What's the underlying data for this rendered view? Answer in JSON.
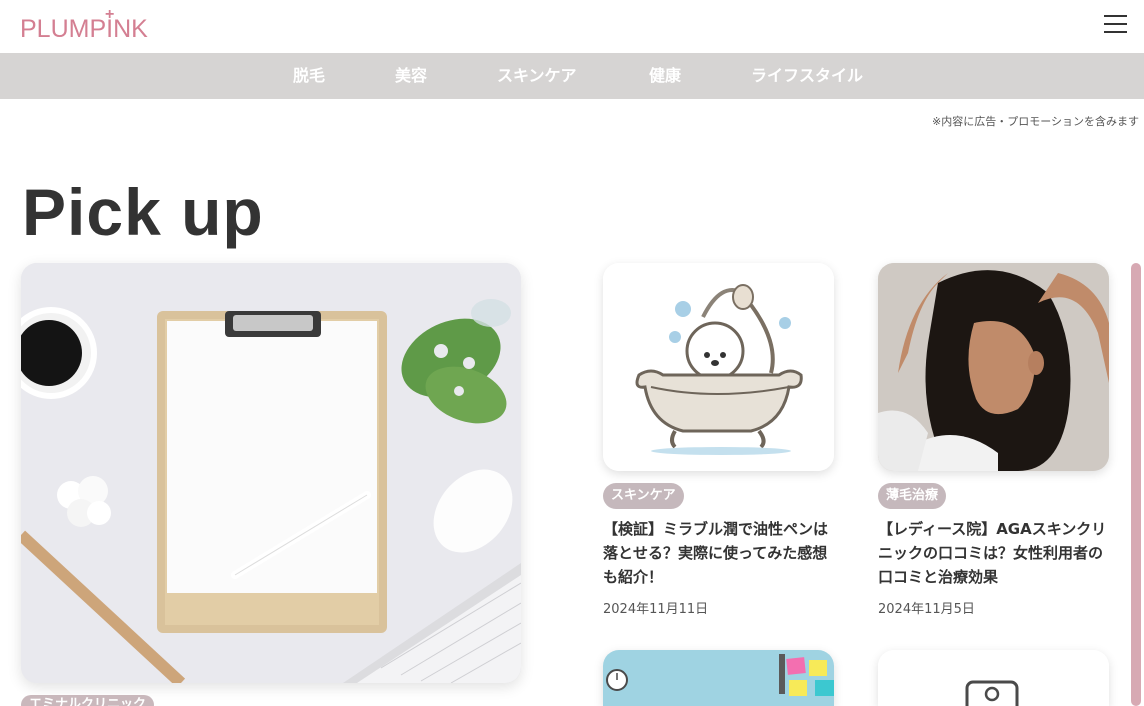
{
  "site": {
    "logo_text": "PLUMPINK",
    "logo_plus": "+"
  },
  "nav": {
    "items": [
      {
        "label": "脱毛"
      },
      {
        "label": "美容"
      },
      {
        "label": "スキンケア"
      },
      {
        "label": "健康"
      },
      {
        "label": "ライフスタイル"
      }
    ]
  },
  "disclaimer": "※内容に広告・プロモーションを含みます",
  "pickup": {
    "title": "Pick up",
    "hero_tag": "エミナルクリニック",
    "cards": [
      {
        "tag": "スキンケア",
        "title": "【検証】ミラブル潤で油性ペンは落とせる？実際に使ってみた感想も紹介！",
        "date": "2024年11月11日"
      },
      {
        "tag": "薄毛治療",
        "title": "【レディース院】AGAスキンクリニックの口コミは？女性利用者の口コミと治療効果",
        "date": "2024年11月5日"
      }
    ]
  },
  "colors": {
    "brand": "#d47f92",
    "nav_bg": "#d6d4d3",
    "tag_bg": "#c5b8bc"
  },
  "icons": {
    "menu": "hamburger-menu-icon"
  }
}
